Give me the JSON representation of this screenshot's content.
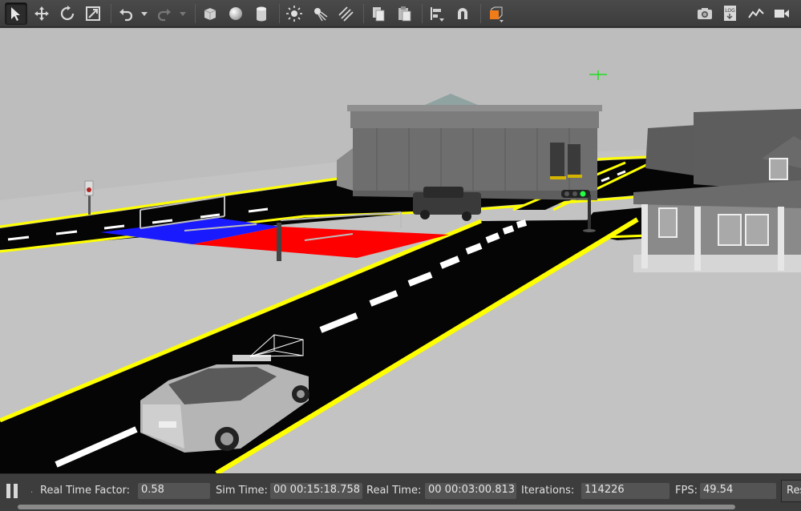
{
  "toolbar": {
    "left_icons": [
      "select-mode-icon",
      "translate-icon",
      "rotate-icon",
      "scale-icon",
      "undo-icon",
      "undo-dropdown-icon",
      "redo-icon",
      "redo-dropdown-icon",
      "box-icon",
      "sphere-icon",
      "cylinder-icon",
      "point-light-icon",
      "spot-light-icon",
      "directional-light-icon",
      "copy-icon",
      "paste-icon",
      "align-icon",
      "snap-icon",
      "view-angle-icon"
    ],
    "right_icons": [
      "screenshot-icon",
      "log-icon",
      "plot-icon",
      "record-video-icon"
    ],
    "log_badge": "LOG"
  },
  "status": {
    "real_time_factor_label": "Real Time Factor:",
    "real_time_factor_value": "0.58",
    "sim_time_label": "Sim Time:",
    "sim_time_value": "00 00:15:18.758",
    "real_time_label": "Real Time:",
    "real_time_value": "00 00:03:00.813",
    "iterations_label": "Iterations:",
    "iterations_value": "114226",
    "fps_label": "FPS:",
    "fps_value": "49.54",
    "reset_label": "Reset Time"
  },
  "colors": {
    "toolbar_bg": "#434343",
    "ground": "#bfbfbf",
    "road": "#050505",
    "road_edge": "#ffff00",
    "lane_marking": "#ffffff",
    "blue_zone": "#1a1aff",
    "red_zone": "#ff0000",
    "accent_orange": "#f07b19"
  }
}
